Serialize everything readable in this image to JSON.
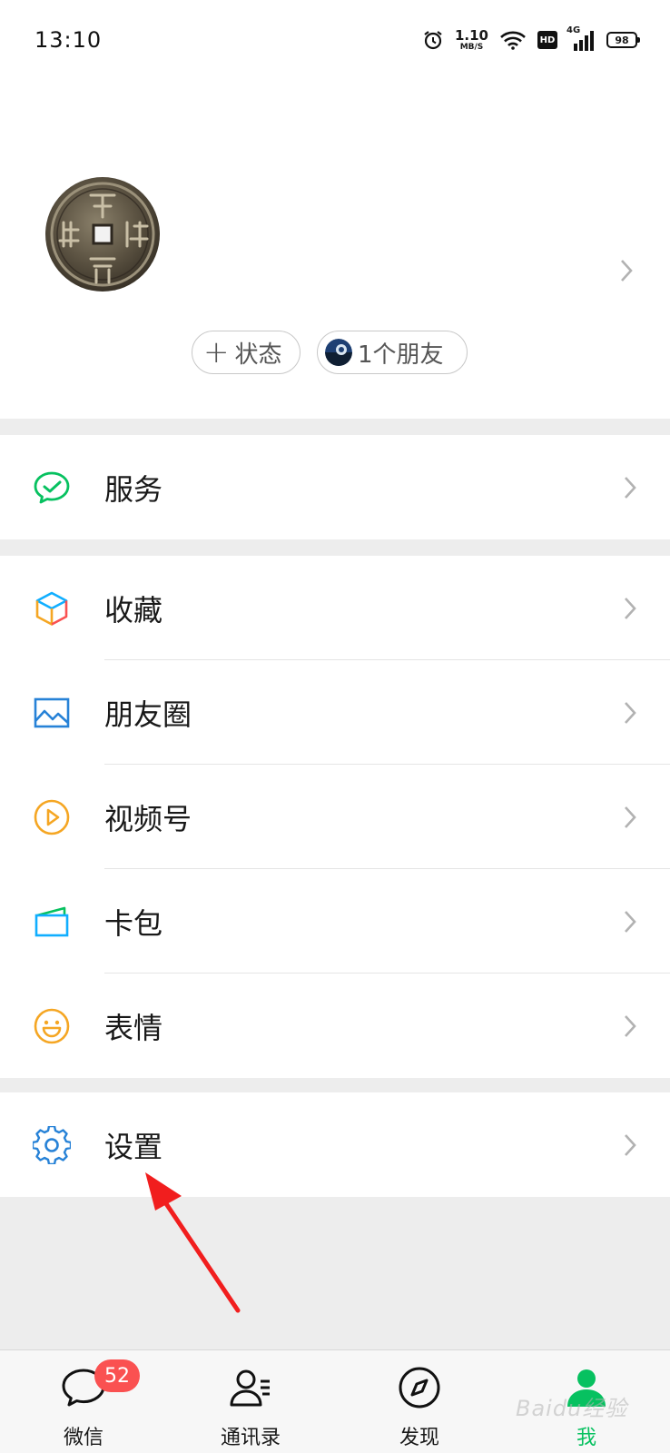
{
  "status_bar": {
    "time": "13:10",
    "net_speed_value": "1.10",
    "net_speed_unit": "MB/S",
    "hd_label": "HD",
    "network_type": "4G",
    "battery": "98",
    "icons": [
      "alarm-icon",
      "wifi-icon",
      "hd-icon",
      "signal-icon",
      "battery-icon"
    ]
  },
  "profile": {
    "avatar": "coin-avatar",
    "status_chip": {
      "icon": "+",
      "label": "状态"
    },
    "friends_chip": {
      "label": "1个朋友"
    }
  },
  "menu": {
    "services": {
      "label": "服务",
      "icon": "wechat-pay-icon",
      "color": "#07c160"
    },
    "favorites": {
      "label": "收藏",
      "icon": "cube-icon"
    },
    "moments": {
      "label": "朋友圈",
      "icon": "image-icon",
      "color": "#2782d7"
    },
    "channels": {
      "label": "视频号",
      "icon": "play-icon",
      "color": "#f5a623"
    },
    "cards": {
      "label": "卡包",
      "icon": "card-icon",
      "color": "#10aeff"
    },
    "stickers": {
      "label": "表情",
      "icon": "smile-icon",
      "color": "#f5a623"
    },
    "settings": {
      "label": "设置",
      "icon": "gear-icon",
      "color": "#2782d7"
    }
  },
  "tabbar": {
    "chats": {
      "label": "微信",
      "badge": "52"
    },
    "contacts": {
      "label": "通讯录"
    },
    "discover": {
      "label": "发现"
    },
    "me": {
      "label": "我",
      "active": true,
      "active_color": "#07c160"
    }
  },
  "watermark": "Baidu经验"
}
